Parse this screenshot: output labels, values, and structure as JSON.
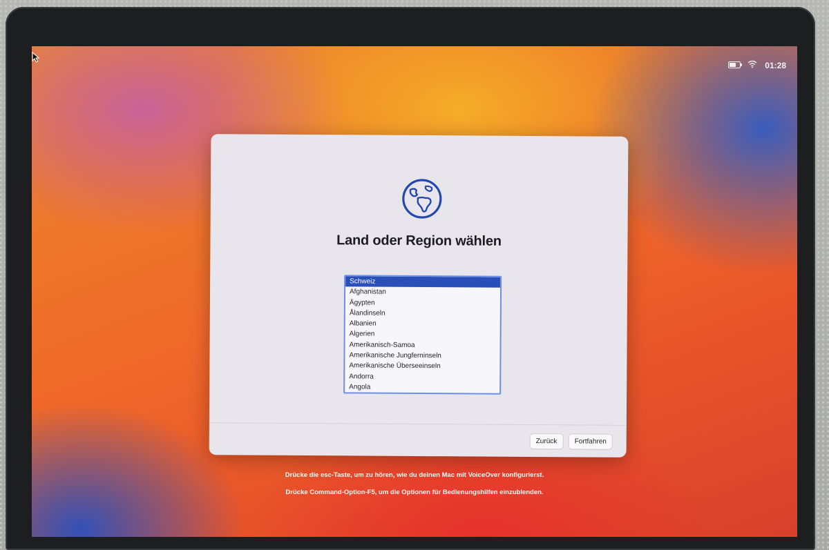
{
  "menubar": {
    "clock": "01:28",
    "icons": [
      "battery-icon",
      "wifi-icon"
    ]
  },
  "dialog": {
    "icon": "globe-icon",
    "title": "Land oder Region wählen",
    "countries": [
      "Schweiz",
      "Afghanistan",
      "Ägypten",
      "Ålandinseln",
      "Albanien",
      "Algerien",
      "Amerikanisch-Samoa",
      "Amerikanische Jungferninseln",
      "Amerikanische Überseeinseln",
      "Andorra",
      "Angola"
    ],
    "selected_country": "Schweiz",
    "back_label": "Zurück",
    "continue_label": "Fortfahren"
  },
  "hints": {
    "voiceover": "Drücke die esc-Taste, um zu hören, wie du deinen Mac mit VoiceOver konfigurierst.",
    "accessibility": "Drücke Command-Option-F5, um die Optionen für Bedienungshilfen einzublenden."
  },
  "colors": {
    "accent": "#2a4fb8",
    "globe": "#2448b0"
  }
}
